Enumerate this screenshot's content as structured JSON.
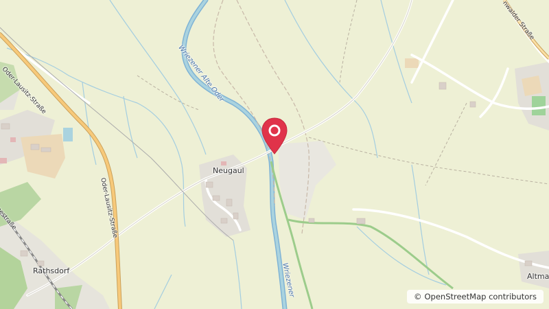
{
  "map": {
    "places": {
      "neugaul": "Neugaul",
      "rathsdorf": "Rathsdorf",
      "altmad": "Altmad"
    },
    "roads": {
      "oder_lausitz_top": "Oder-Lausitz-Straße",
      "oder_lausitz_mid": "Oder-Lausitz-Straße",
      "walder_strasse": "nwalder Straße",
      "seestrasse_fragment": "eestraße"
    },
    "waterways": {
      "alte_oder": "Wriezener Alte Oder",
      "wriezener_bottom": "Wriezener"
    },
    "marker": {
      "icon": "map-pin-icon",
      "color": "#e0334a"
    },
    "attribution": {
      "symbol": "©",
      "text": "OpenStreetMap contributors"
    },
    "colors": {
      "farmland": "#eef0d5",
      "water": "#aad3df",
      "river_stroke": "#7fb3d5",
      "forest": "#add19e",
      "residential": "#e0dfdf",
      "road_major": "#f7c97a",
      "road_major_casing": "#c9a05a"
    }
  }
}
